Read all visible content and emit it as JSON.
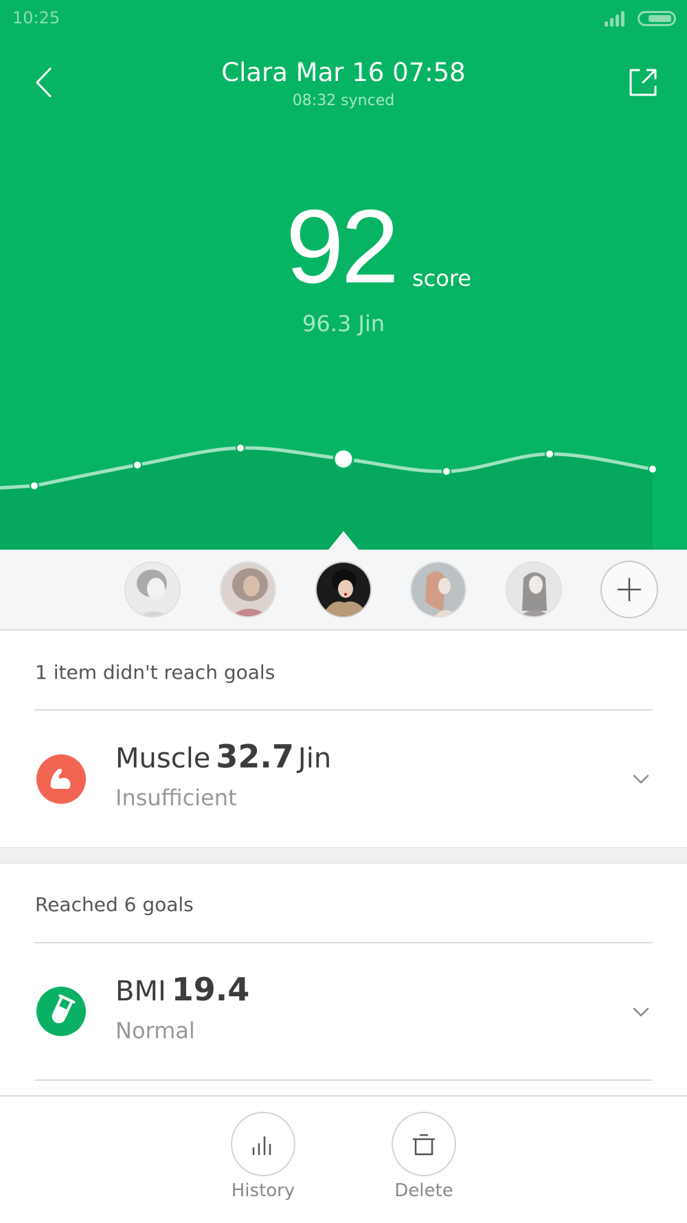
{
  "status_bar": {
    "time": "10:25",
    "signal_icon": "signal-bars-icon",
    "battery_icon": "battery-icon"
  },
  "header": {
    "title": "Clara Mar 16 07:58",
    "subtitle": "08:32 synced",
    "back_icon": "chevron-left-icon",
    "share_icon": "share-external-icon"
  },
  "score": {
    "value": "92",
    "unit": "score",
    "weight": "96.3 Jin"
  },
  "colors": {
    "brand_green": "#07b464",
    "chart_fill": "#05a85d",
    "chart_line": "#9fe2bf",
    "alert_red": "#f26552",
    "ok_green": "#0ab165"
  },
  "chart_data": {
    "type": "line",
    "title": "",
    "xlabel": "",
    "ylabel": "",
    "description": "Score trend across 7 measurements (relative levels, no axis shown); highlighted point is the current measurement",
    "x": [
      1,
      2,
      3,
      4,
      5,
      6,
      7
    ],
    "values": [
      0.0,
      0.55,
      1.0,
      0.71,
      0.38,
      0.84,
      0.44
    ],
    "selected_index": 3,
    "selected_value_label": "92",
    "grid": false,
    "legend": "none"
  },
  "profiles": {
    "items": [
      {
        "name": "profile-1",
        "selected": false,
        "tone": [
          "#d8d8d8",
          "#6d6d6d"
        ]
      },
      {
        "name": "profile-2",
        "selected": false,
        "tone": [
          "#b9927d",
          "#9b2d3a"
        ]
      },
      {
        "name": "profile-3",
        "selected": true,
        "tone": [
          "#1a1a1a",
          "#b89a7a"
        ]
      },
      {
        "name": "profile-4",
        "selected": false,
        "tone": [
          "#a9aeb2",
          "#b5562e"
        ]
      },
      {
        "name": "profile-5",
        "selected": false,
        "tone": [
          "#d6d4cf",
          "#5b5652"
        ]
      }
    ],
    "add_icon": "plus-icon"
  },
  "sections": {
    "unmet": {
      "heading": "1 item didn't reach goals",
      "items": [
        {
          "name": "Muscle",
          "value": "32.7",
          "unit": "Jin",
          "status": "Insufficient",
          "icon": "muscle-arm-icon"
        }
      ]
    },
    "met": {
      "heading": "Reached 6 goals",
      "items": [
        {
          "name": "BMI",
          "value": "19.4",
          "unit": "",
          "status": "Normal",
          "icon": "test-tube-icon"
        }
      ]
    }
  },
  "bottom_bar": {
    "history_label": "History",
    "delete_label": "Delete",
    "history_icon": "bar-chart-icon",
    "delete_icon": "trash-icon"
  }
}
